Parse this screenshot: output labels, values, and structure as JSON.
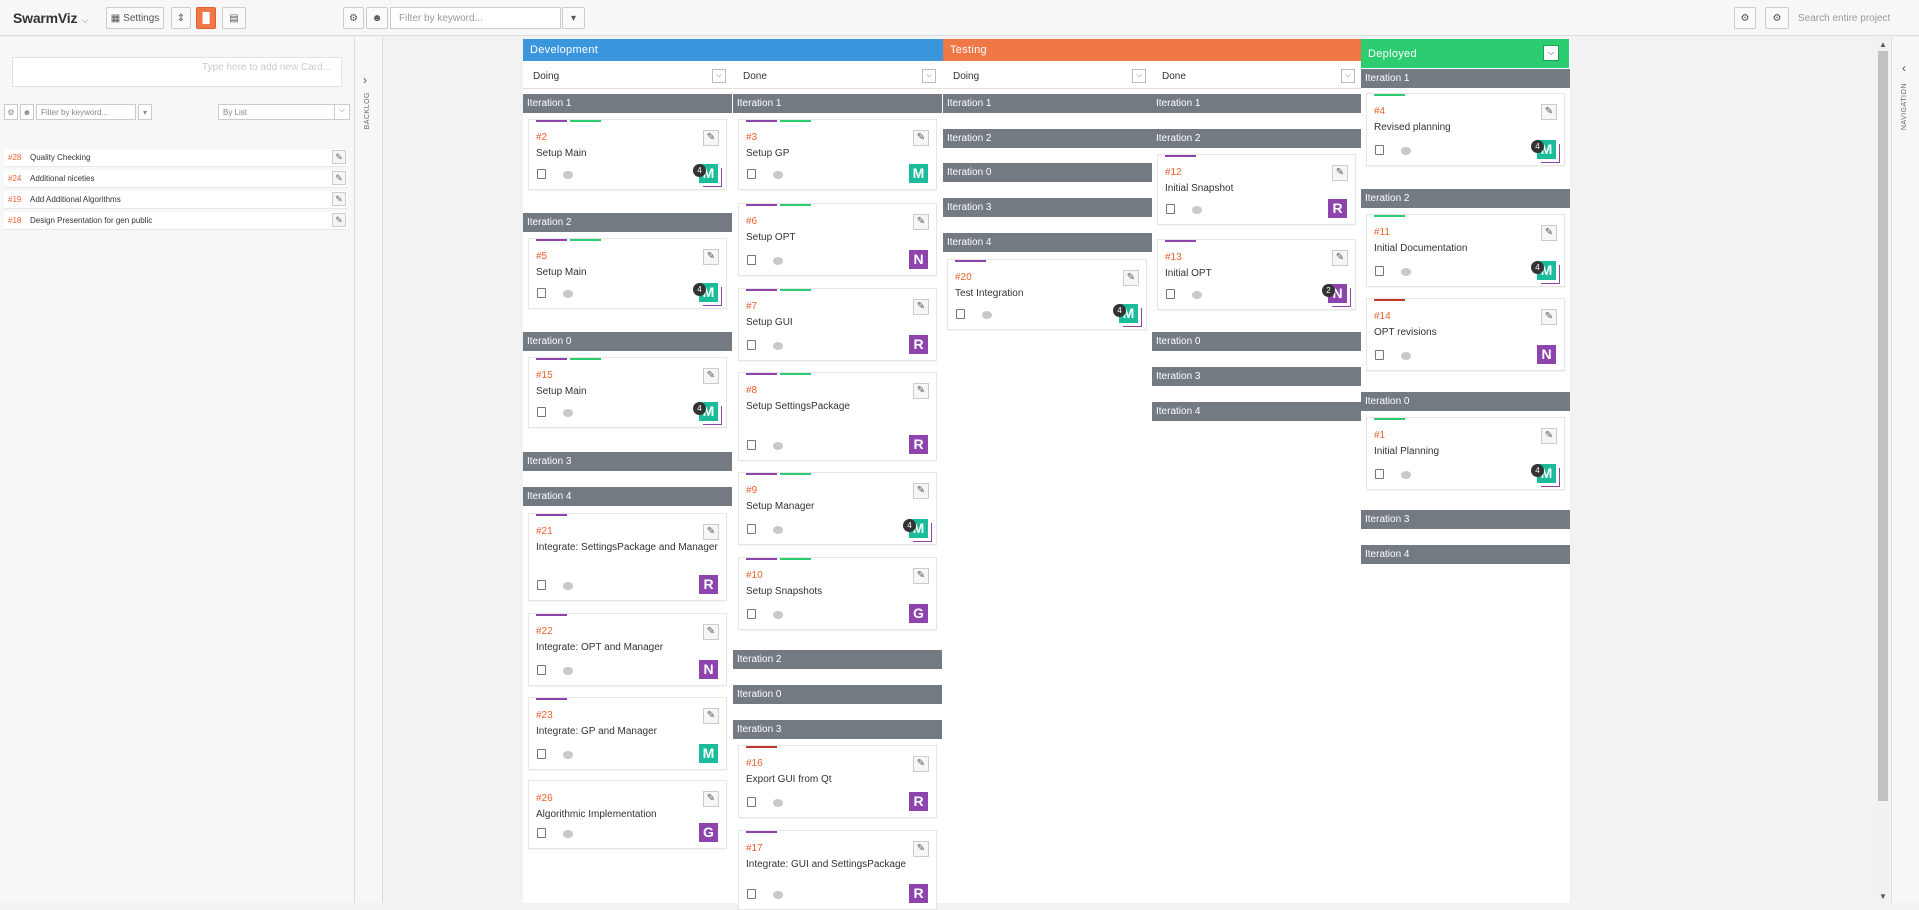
{
  "app": {
    "title": "SwarmViz",
    "settings_label": "Settings",
    "filter_placeholder": "Filter by keyword...",
    "search_placeholder": "Search entire project"
  },
  "sidebar": {
    "add_card_placeholder": "Type here to add new Card...",
    "filter_placeholder": "Filter by keyword...",
    "group_by": "By List",
    "tab_label": "BACKLOG",
    "items": [
      {
        "num": "#28",
        "title": "Quality Checking"
      },
      {
        "num": "#24",
        "title": "Additional niceties"
      },
      {
        "num": "#19",
        "title": "Add Additional Algorithms"
      },
      {
        "num": "#18",
        "title": "Design Presentation for gen public"
      }
    ]
  },
  "nav_tab_label": "NAVIGATION",
  "colors": {
    "development": "#3a96dd",
    "testing": "#f07746",
    "deployed": "#2ecc71",
    "iteration": "#737a82",
    "number": "#e8612c",
    "M": "#1abc9c",
    "R": "#8e44ad",
    "N": "#8e44ad",
    "G": "#8e44ad",
    "label_purple": "#8e44ad",
    "label_green": "#2ecc71",
    "label_red": "#c0392b"
  },
  "board": {
    "groups": [
      {
        "name": "Development",
        "color": "#3a96dd"
      },
      {
        "name": "Testing",
        "color": "#f07746"
      },
      {
        "name": "Deployed",
        "color": "#2ecc71"
      }
    ],
    "columns": [
      {
        "name": "Doing"
      },
      {
        "name": "Done"
      },
      {
        "name": "Doing"
      },
      {
        "name": "Done"
      }
    ],
    "iterations": {
      "dev_doing": [
        "Iteration 1",
        "Iteration 2",
        "Iteration 0",
        "Iteration 3",
        "Iteration 4"
      ],
      "dev_done": [
        "Iteration 1",
        "Iteration 2",
        "Iteration 0",
        "Iteration 3"
      ],
      "test_doing": [
        "Iteration 1",
        "Iteration 2",
        "Iteration 0",
        "Iteration 3",
        "Iteration 4"
      ],
      "test_done": [
        "Iteration 1",
        "Iteration 2",
        "Iteration 0",
        "Iteration 3",
        "Iteration 4"
      ],
      "deployed": [
        "Iteration 1",
        "Iteration 2",
        "Iteration 0",
        "Iteration 3",
        "Iteration 4"
      ]
    },
    "cards": {
      "dev_doing": [
        {
          "num": "#2",
          "title": "Setup Main",
          "avatar": "M",
          "badge": "4",
          "labels": [
            "purple",
            "green"
          ]
        },
        {
          "num": "#5",
          "title": "Setup Main",
          "avatar": "M",
          "badge": "4",
          "labels": [
            "purple",
            "green"
          ]
        },
        {
          "num": "#15",
          "title": "Setup Main",
          "avatar": "M",
          "badge": "4",
          "labels": [
            "purple",
            "green"
          ]
        },
        {
          "num": "#21",
          "title": "Integrate: SettingsPackage and Manager",
          "avatar": "R",
          "badge": "",
          "labels": [
            "purple"
          ]
        },
        {
          "num": "#22",
          "title": "Integrate: OPT and Manager",
          "avatar": "N",
          "badge": "",
          "labels": [
            "purple"
          ]
        },
        {
          "num": "#23",
          "title": "Integrate: GP and Manager",
          "avatar": "M",
          "badge": "",
          "labels": [
            "purple"
          ]
        },
        {
          "num": "#26",
          "title": "Algorithmic Implementation",
          "avatar": "G",
          "badge": "",
          "labels": []
        }
      ],
      "dev_done": [
        {
          "num": "#3",
          "title": "Setup GP",
          "avatar": "M",
          "badge": "",
          "labels": [
            "purple",
            "green"
          ]
        },
        {
          "num": "#6",
          "title": "Setup OPT",
          "avatar": "N",
          "badge": "",
          "labels": [
            "purple",
            "green"
          ]
        },
        {
          "num": "#7",
          "title": "Setup GUI",
          "avatar": "R",
          "badge": "",
          "labels": [
            "purple",
            "green"
          ]
        },
        {
          "num": "#8",
          "title": "Setup SettingsPackage",
          "avatar": "R",
          "badge": "",
          "labels": [
            "purple",
            "green"
          ]
        },
        {
          "num": "#9",
          "title": "Setup Manager",
          "avatar": "M",
          "badge": "4",
          "labels": [
            "purple",
            "green"
          ]
        },
        {
          "num": "#10",
          "title": "Setup Snapshots",
          "avatar": "G",
          "badge": "",
          "labels": [
            "purple",
            "green"
          ]
        },
        {
          "num": "#16",
          "title": "Export GUI from Qt",
          "avatar": "R",
          "badge": "",
          "labels": [
            "red"
          ]
        },
        {
          "num": "#17",
          "title": "Integrate: GUI and SettingsPackage",
          "avatar": "R",
          "badge": "",
          "labels": [
            "purple"
          ]
        }
      ],
      "test_doing": [
        {
          "num": "#20",
          "title": "Test Integration",
          "avatar": "M",
          "badge": "4",
          "labels": [
            "purple"
          ]
        }
      ],
      "test_done": [
        {
          "num": "#12",
          "title": "Initial Snapshot",
          "avatar": "R",
          "badge": "",
          "labels": [
            "purple"
          ]
        },
        {
          "num": "#13",
          "title": "Initial OPT",
          "avatar": "N",
          "badge": "2",
          "labels": [
            "purple"
          ]
        }
      ],
      "deployed": [
        {
          "num": "#4",
          "title": "Revised planning",
          "avatar": "M",
          "badge": "4",
          "labels": [
            "green"
          ]
        },
        {
          "num": "#11",
          "title": "Initial Documentation",
          "avatar": "M",
          "badge": "4",
          "labels": [
            "green"
          ]
        },
        {
          "num": "#14",
          "title": "OPT revisions",
          "avatar": "N",
          "badge": "",
          "labels": [
            "red"
          ]
        },
        {
          "num": "#1",
          "title": "Initial Planning",
          "avatar": "M",
          "badge": "4",
          "labels": [
            "green"
          ]
        }
      ]
    }
  }
}
